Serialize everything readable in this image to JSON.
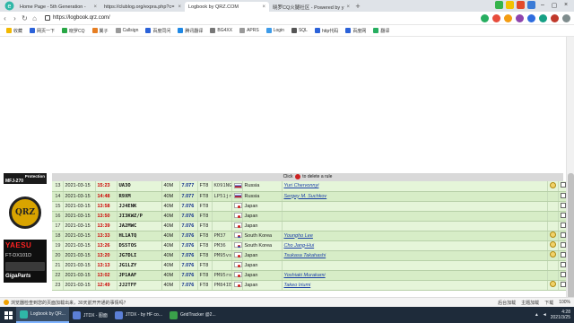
{
  "browser": {
    "tabs": [
      {
        "label": "Home Page - 5th Generation -",
        "active": false
      },
      {
        "label": "https://clublog.org/expra.php?c=",
        "active": false
      },
      {
        "label": "Logbook by QRZ.COM",
        "active": true
      },
      {
        "label": "晓罗CQ火腿社区 - Powered by y",
        "active": false
      }
    ],
    "new_tab": "+",
    "url": "https://logbook.qrz.com/",
    "bookmarks": [
      "收藏",
      "网页一下",
      "晓罗CQ",
      "翼子",
      "Callsign",
      "百度同问",
      "腾讯翻译",
      "BG4XX",
      "APRS",
      "Login",
      "SQL",
      "http代码",
      "百度网",
      "翻译"
    ]
  },
  "page": {
    "rule_bar": {
      "before": "Click",
      "after": "to delete a rule"
    },
    "ads": {
      "mfj": {
        "brand": "MFJ-270",
        "tag": "Protection"
      },
      "qrz_badge": "QRZ",
      "yaesu": {
        "brand": "YAESU",
        "model": "FT-DX101D",
        "store": "GigaParts"
      }
    },
    "log_rows": [
      {
        "num": "13",
        "date": "2021-03-15",
        "time": "15:23",
        "call": "UA3O",
        "band": "40M",
        "freq": "7.077",
        "mode": "FT8",
        "grid": "KO91NG",
        "flag": "ru",
        "country": "Russia",
        "name": "Yuri Chervonnyi",
        "qsl": true
      },
      {
        "num": "14",
        "date": "2021-03-15",
        "time": "14:48",
        "call": "R9XM",
        "band": "40M",
        "freq": "7.077",
        "mode": "FT8",
        "grid": "LP51jr",
        "flag": "ru",
        "country": "Russia",
        "name": "Sergey M. Suchkov",
        "qsl": false
      },
      {
        "num": "15",
        "date": "2021-03-15",
        "time": "13:58",
        "call": "JJ4ENK",
        "band": "40M",
        "freq": "7.076",
        "mode": "FT8",
        "grid": "",
        "flag": "jp",
        "country": "Japan",
        "name": "",
        "qsl": false
      },
      {
        "num": "16",
        "date": "2021-03-15",
        "time": "13:50",
        "call": "JI3KWZ/P",
        "band": "40M",
        "freq": "7.076",
        "mode": "FT8",
        "grid": "",
        "flag": "jp",
        "country": "Japan",
        "name": "",
        "qsl": false
      },
      {
        "num": "17",
        "date": "2021-03-15",
        "time": "13:39",
        "call": "JA2MWC",
        "band": "40M",
        "freq": "7.076",
        "mode": "FT8",
        "grid": "",
        "flag": "jp",
        "country": "Japan",
        "name": "",
        "qsl": false
      },
      {
        "num": "18",
        "date": "2021-03-15",
        "time": "13:33",
        "call": "HL1ATQ",
        "band": "40M",
        "freq": "7.076",
        "mode": "FT8",
        "grid": "PM37",
        "flag": "kr",
        "country": "South Korea",
        "name": "Youngho Lee",
        "qsl": true
      },
      {
        "num": "19",
        "date": "2021-03-15",
        "time": "13:26",
        "call": "DS5TOS",
        "band": "40M",
        "freq": "7.076",
        "mode": "FT8",
        "grid": "PM36",
        "flag": "kr",
        "country": "South Korea",
        "name": "Cho Jang-Hui",
        "qsl": true
      },
      {
        "num": "20",
        "date": "2021-03-15",
        "time": "13:20",
        "call": "JG7DLI",
        "band": "40M",
        "freq": "7.076",
        "mode": "FT8",
        "grid": "PM95vs",
        "flag": "jp",
        "country": "Japan",
        "name": "Tsukasa Takahashi",
        "qsl": true
      },
      {
        "num": "21",
        "date": "2021-03-15",
        "time": "13:13",
        "call": "JG1LZY",
        "band": "40M",
        "freq": "7.076",
        "mode": "FT8",
        "grid": "",
        "flag": "jp",
        "country": "Japan",
        "name": "",
        "qsl": false
      },
      {
        "num": "22",
        "date": "2021-03-15",
        "time": "13:02",
        "call": "JP1AAF",
        "band": "40M",
        "freq": "7.076",
        "mode": "FT8",
        "grid": "PM95ro",
        "flag": "jp",
        "country": "Japan",
        "name": "Yoshiaki Murakami",
        "qsl": false
      },
      {
        "num": "23",
        "date": "2021-03-15",
        "time": "12:49",
        "call": "JJ2TFF",
        "band": "40M",
        "freq": "7.076",
        "mode": "FT8",
        "grid": "PM84IE",
        "flag": "jp",
        "country": "Japan",
        "name": "Takeo Iriumi",
        "qsl": true
      }
    ]
  },
  "statusbar": {
    "warning": "浏览器检查到您的页面加载出来，30天前开开通的事情吗？",
    "right_items": [
      "后台加载",
      "主题加载",
      "下载",
      "100%"
    ]
  },
  "taskbar": {
    "apps": [
      {
        "label": "Logbook by QR...",
        "active": true
      },
      {
        "label": "JTDX - 图面",
        "active": false
      },
      {
        "label": "JTDX - by HF co...",
        "active": false
      },
      {
        "label": "GridTracker @2...",
        "active": false
      }
    ],
    "time": "4:28",
    "date": "2021/3/25"
  },
  "colors": {
    "row_bg": "#e5f5d9",
    "time_red": "#cc0000",
    "freq_blue": "#0b2a8a",
    "taskbar": "#1e2b3a"
  }
}
